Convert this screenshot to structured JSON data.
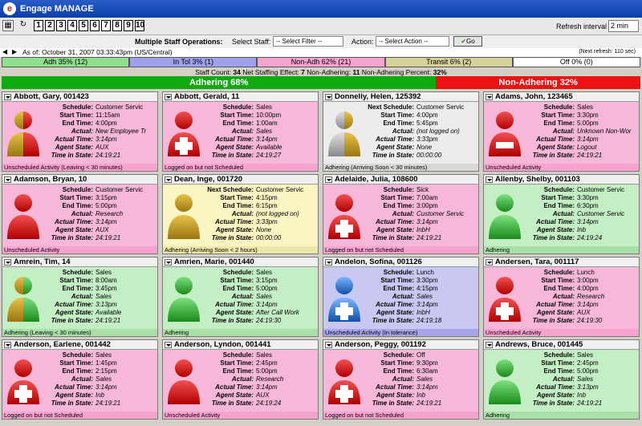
{
  "app": {
    "title": "Engage MANAGE",
    "logo_letter": "e"
  },
  "toolbar": {
    "tabs": [
      "1",
      "2",
      "3",
      "4",
      "5",
      "6",
      "7",
      "8",
      "9",
      "10"
    ],
    "refresh_label": "Refresh interval",
    "refresh_value": "2 min"
  },
  "ops": {
    "title": "Multiple Staff Operations:",
    "select_staff_label": "Select Staff:",
    "filter_placeholder": "-- Select Filter --",
    "action_label": "Action:",
    "action_placeholder": "-- Select Action --",
    "go_label": "Go"
  },
  "asof": {
    "text": "As of:  October 31, 2007 03:33:43pm   (US/Central)",
    "next_refresh": "(Next refresh: 110 sec)"
  },
  "categories": [
    {
      "label": "Adh 35% (12)",
      "color": "#8ee08e",
      "pct": 35
    },
    {
      "label": "In Tol 3% (1)",
      "color": "#9fa0ee",
      "pct": 3
    },
    {
      "label": "Non-Adh 62% (21)",
      "color": "#f7a3cf",
      "pct": 62
    },
    {
      "label": "Transit 6% (2)",
      "color": "#d6d39a",
      "pct": 6
    },
    {
      "label": "Off 0% (0)",
      "color": "#ffffff",
      "pct": 0
    }
  ],
  "counts": {
    "staff_label": "Staff Count:",
    "staff_value": "34",
    "net_label": "Net Staffing Effect:",
    "net_value": "7",
    "nonadh_label": "Non-Adhering:",
    "nonadh_value": "11",
    "nonadhpct_label": "Non-Adhering Percent:",
    "nonadhpct_value": "32%"
  },
  "adherence": {
    "adhering_label": "Adhering 68%",
    "adhering_pct": 68,
    "adhering_color": "#10aa10",
    "nonadhering_label": "Non-Adhering 32%",
    "nonadhering_pct": 32,
    "nonadhering_color": "#ee1111"
  },
  "labels": {
    "schedule": "Schedule:",
    "next_schedule": "Next Schedule:",
    "start": "Start Time:",
    "end": "End Time:",
    "actual": "Actual:",
    "actual_time": "Actual Time:",
    "agent_state": "Agent State:",
    "time_in_state": "Time in State:"
  },
  "agents": [
    {
      "name": "Abbott, Gary, 001423",
      "schedule": "Customer Servic",
      "start": "11:15am",
      "end": "4:00pm",
      "actual": "New Employee Tr",
      "actual_time": "3:14pm",
      "agent_state": "AUX",
      "time_in_state": "24:19:21",
      "footer": "Unscheduled Activity (Leaving < 30 minutes)",
      "bg": "#f7b7d9",
      "foot_bg": "#f7a3cf",
      "icon": "half",
      "mark": "none",
      "next": false
    },
    {
      "name": "Abbott, Gerald, 11",
      "schedule": "Sales",
      "start": "10:00pm",
      "end": "1:00am",
      "actual": "Sales",
      "actual_time": "3:14pm",
      "agent_state": "Available",
      "time_in_state": "24:19:27",
      "footer": "Logged on but not Scheduled",
      "bg": "#f7b7d9",
      "foot_bg": "#f7a3cf",
      "icon": "red",
      "mark": "plus",
      "next": false
    },
    {
      "name": "Donnelly, Helen, 125392",
      "schedule": "Customer Servic",
      "start": "4:00pm",
      "end": "5:45pm",
      "actual": "(not logged on)",
      "actual_time": "3:33pm",
      "agent_state": "None",
      "time_in_state": "00:00:00",
      "footer": "Adhering (Arriving Soon < 30 minutes)",
      "bg": "#ececec",
      "foot_bg": "#d8d8d8",
      "icon": "halfgray",
      "mark": "none",
      "next": true
    },
    {
      "name": "Adams, John, 123465",
      "schedule": "Sales",
      "start": "3:30pm",
      "end": "5:00pm",
      "actual": "Unknown Non-Wor",
      "actual_time": "3:14pm",
      "agent_state": "Logout",
      "time_in_state": "24:19:21",
      "footer": "Unscheduled Activity",
      "bg": "#f7b7d9",
      "foot_bg": "#f7a3cf",
      "icon": "red",
      "mark": "minus",
      "next": false
    },
    {
      "name": "Adamson, Bryan, 10",
      "schedule": "Customer Servic",
      "start": "3:15pm",
      "end": "5:00pm",
      "actual": "Research",
      "actual_time": "3:14pm",
      "agent_state": "AUX",
      "time_in_state": "24:19:21",
      "footer": "Unscheduled Activity",
      "bg": "#f7b7d9",
      "foot_bg": "#f7a3cf",
      "icon": "red",
      "mark": "none",
      "next": false
    },
    {
      "name": "Dean, Inge, 001720",
      "schedule": "Customer Servic",
      "start": "4:15pm",
      "end": "6:15pm",
      "actual": "(not logged on)",
      "actual_time": "3:33pm",
      "agent_state": "None",
      "time_in_state": "00:00:00",
      "footer": "Adhering (Arriving Soon < 2 hours)",
      "bg": "#fbf5c4",
      "foot_bg": "#ece6a8",
      "icon": "gold",
      "mark": "none",
      "next": true
    },
    {
      "name": "Adelaide, Julia, 108600",
      "schedule": "Sick",
      "start": "7:00am",
      "end": "3:00pm",
      "actual": "Customer Servic",
      "actual_time": "3:14pm",
      "agent_state": "InbH",
      "time_in_state": "24:19:21",
      "footer": "Logged on but not Scheduled",
      "bg": "#f7b7d9",
      "foot_bg": "#f7a3cf",
      "icon": "red",
      "mark": "plus",
      "next": false
    },
    {
      "name": "Allenby, Shelby, 001103",
      "schedule": "Customer Servic",
      "start": "3:30pm",
      "end": "6:30pm",
      "actual": "Customer Servic",
      "actual_time": "3:14pm",
      "agent_state": "Inb",
      "time_in_state": "24:19:24",
      "footer": "Adhering",
      "bg": "#c4eec4",
      "foot_bg": "#a8e0a8",
      "icon": "green",
      "mark": "none",
      "next": false
    },
    {
      "name": "Amrein, Tim, 14",
      "schedule": "Sales",
      "start": "8:00am",
      "end": "3:45pm",
      "actual": "Sales",
      "actual_time": "3:13pm",
      "agent_state": "Available",
      "time_in_state": "24:19:21",
      "footer": "Adhering (Leaving < 30 minutes)",
      "bg": "#c4eec4",
      "foot_bg": "#a8e0a8",
      "icon": "halfgreen",
      "mark": "none",
      "next": false
    },
    {
      "name": "Amrien, Marie, 001440",
      "schedule": "Sales",
      "start": "3:15pm",
      "end": "5:00pm",
      "actual": "Sales",
      "actual_time": "3:14pm",
      "agent_state": "After Call Work",
      "time_in_state": "24:19:30",
      "footer": "Adhering",
      "bg": "#c4eec4",
      "foot_bg": "#a8e0a8",
      "icon": "green",
      "mark": "none",
      "next": false
    },
    {
      "name": "Andelon, Sofina, 001126",
      "schedule": "Lunch",
      "start": "3:30pm",
      "end": "4:15pm",
      "actual": "Sales",
      "actual_time": "3:14pm",
      "agent_state": "InbH",
      "time_in_state": "24:19:18",
      "footer": "Unscheduled Activity (In tolerance)",
      "bg": "#c8c8f2",
      "foot_bg": "#a6a6ea",
      "icon": "blue",
      "mark": "plus",
      "next": false
    },
    {
      "name": "Andersen, Tara, 001117",
      "schedule": "Lunch",
      "start": "3:00pm",
      "end": "4:00pm",
      "actual": "Research",
      "actual_time": "3:14pm",
      "agent_state": "AUX",
      "time_in_state": "24:19:30",
      "footer": "Unscheduled Activity",
      "bg": "#f7b7d9",
      "foot_bg": "#f7a3cf",
      "icon": "red",
      "mark": "plus",
      "next": false
    },
    {
      "name": "Anderson, Earlene, 001442",
      "schedule": "Sales",
      "start": "1:45pm",
      "end": "2:15pm",
      "actual": "Sales",
      "actual_time": "3:14pm",
      "agent_state": "Inb",
      "time_in_state": "24:19:21",
      "footer": "Logged on but not Scheduled",
      "bg": "#f7b7d9",
      "foot_bg": "#f7a3cf",
      "icon": "red",
      "mark": "plus",
      "next": false
    },
    {
      "name": "Anderson, Lyndon, 001441",
      "schedule": "Sales",
      "start": "2:45pm",
      "end": "5:00pm",
      "actual": "Research",
      "actual_time": "3:14pm",
      "agent_state": "AUX",
      "time_in_state": "24:19:24",
      "footer": "Unscheduled Activity",
      "bg": "#f7b7d9",
      "foot_bg": "#f7a3cf",
      "icon": "red",
      "mark": "none",
      "next": false
    },
    {
      "name": "Anderson, Peggy, 001192",
      "schedule": "Off",
      "start": "9:30pm",
      "end": "6:30am",
      "actual": "Sales",
      "actual_time": "3:14pm",
      "agent_state": "Inb",
      "time_in_state": "24:19:21",
      "footer": "Logged on but not Scheduled",
      "bg": "#f7b7d9",
      "foot_bg": "#f7a3cf",
      "icon": "red",
      "mark": "plus",
      "next": false
    },
    {
      "name": "Andrews, Bruce, 001445",
      "schedule": "Sales",
      "start": "2:45pm",
      "end": "5:00pm",
      "actual": "Sales",
      "actual_time": "3:13pm",
      "agent_state": "Inb",
      "time_in_state": "24:19:21",
      "footer": "Adhering",
      "bg": "#c4eec4",
      "foot_bg": "#a8e0a8",
      "icon": "green",
      "mark": "none",
      "next": false
    }
  ]
}
